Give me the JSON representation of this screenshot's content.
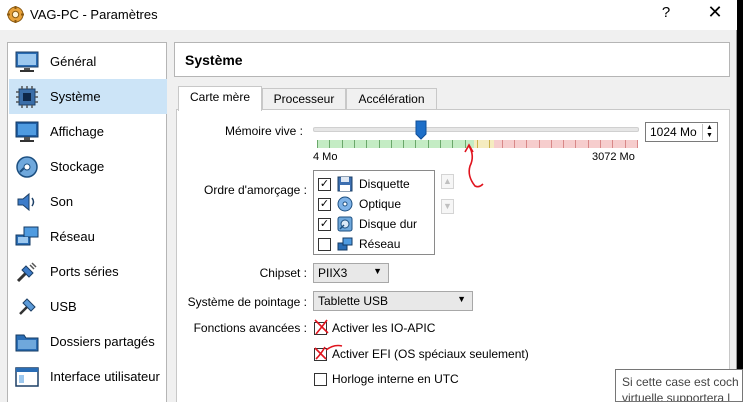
{
  "window": {
    "title": "VAG-PC - Paramètres",
    "help_glyph": "?",
    "close_glyph": "✕"
  },
  "sidebar": {
    "items": [
      {
        "label": "Général",
        "icon": "general-icon",
        "active": false
      },
      {
        "label": "Système",
        "icon": "system-icon",
        "active": true
      },
      {
        "label": "Affichage",
        "icon": "display-icon",
        "active": false
      },
      {
        "label": "Stockage",
        "icon": "storage-icon",
        "active": false
      },
      {
        "label": "Son",
        "icon": "audio-icon",
        "active": false
      },
      {
        "label": "Réseau",
        "icon": "network-icon",
        "active": false
      },
      {
        "label": "Ports séries",
        "icon": "serial-port-icon",
        "active": false
      },
      {
        "label": "USB",
        "icon": "usb-icon",
        "active": false
      },
      {
        "label": "Dossiers partagés",
        "icon": "shared-folder-icon",
        "active": false
      },
      {
        "label": "Interface utilisateur",
        "icon": "user-interface-icon",
        "active": false
      }
    ]
  },
  "section": {
    "title": "Système"
  },
  "tabs": [
    {
      "label": "Carte mère",
      "active": true
    },
    {
      "label": "Processeur",
      "active": false
    },
    {
      "label": "Accélération",
      "active": false
    }
  ],
  "memory": {
    "label": "Mémoire vive :",
    "value": "1024 Mo",
    "min_label": "4 Mo",
    "max_label": "3072 Mo",
    "slider_fraction": 0.332
  },
  "boot_order": {
    "label": "Ordre d'amorçage :",
    "items": [
      {
        "label": "Disquette",
        "checked": true,
        "icon": "floppy-icon"
      },
      {
        "label": "Optique",
        "checked": true,
        "icon": "optical-disc-icon"
      },
      {
        "label": "Disque dur",
        "checked": true,
        "icon": "hard-disk-icon"
      },
      {
        "label": "Réseau",
        "checked": false,
        "icon": "network-boot-icon"
      }
    ],
    "move_up": "▲",
    "move_down": "▼"
  },
  "chipset": {
    "label": "Chipset :",
    "value": "PIIX3"
  },
  "pointing": {
    "label": "Système de pointage :",
    "value": "Tablette USB"
  },
  "features": {
    "label": "Fonctions avancées :",
    "io_apic": {
      "label": "Activer les IO-APIC",
      "checked": false
    },
    "efi": {
      "label": "Activer EFI (OS spéciaux seulement)",
      "checked": false
    },
    "utc": {
      "label": "Horloge interne en UTC",
      "checked": false
    }
  },
  "tooltip": {
    "line1": "Si cette case est coch",
    "line2": "virtuelle supportera l"
  },
  "colors": {
    "selection": "#cce4f7",
    "annotation": "#e0141e",
    "slider_thumb": "#1e6fc8"
  }
}
